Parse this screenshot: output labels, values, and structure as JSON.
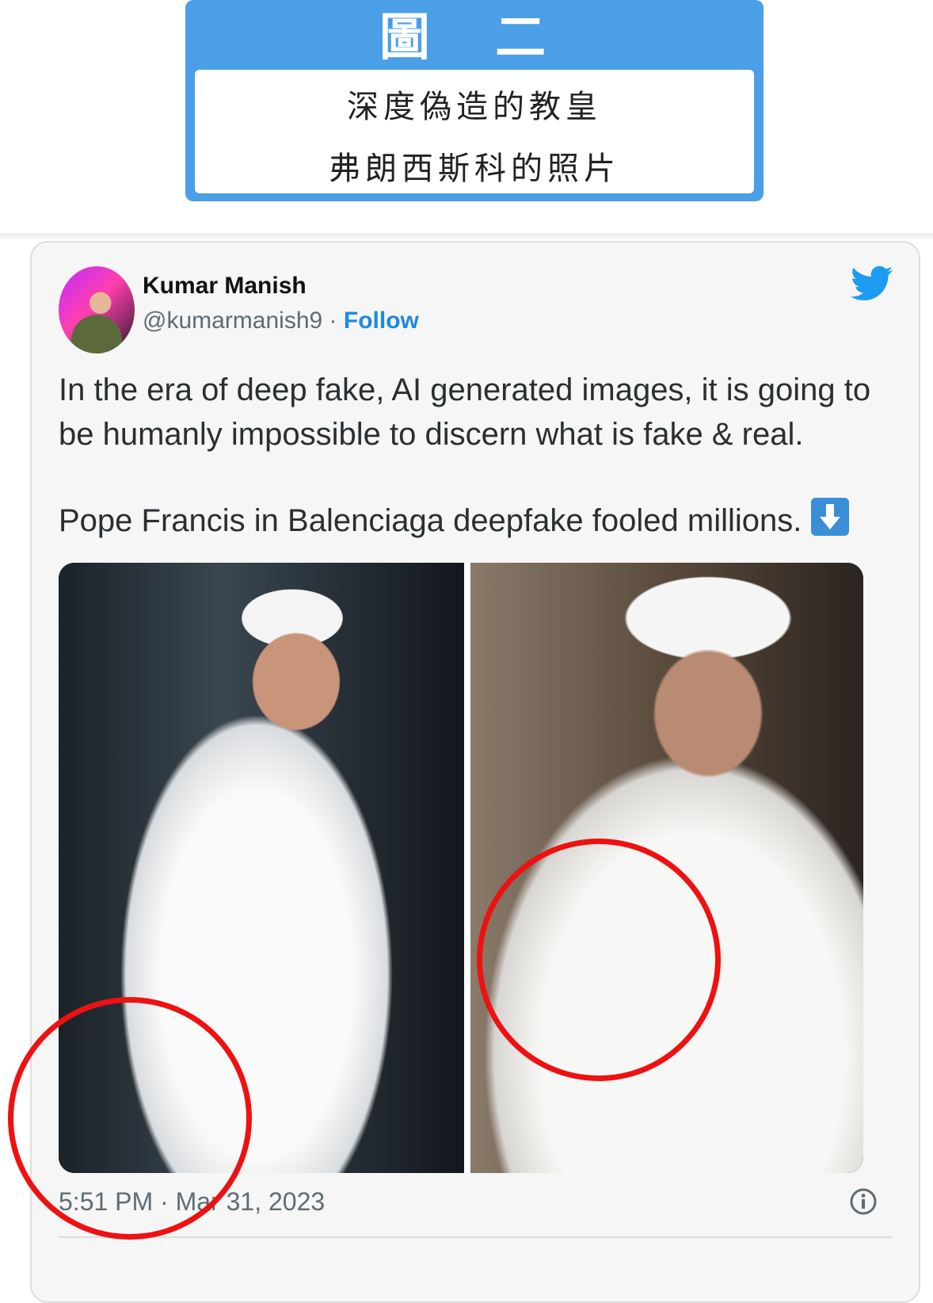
{
  "banner": {
    "title": "圖 二",
    "line1": "深度偽造的教皇",
    "line2": "弗朗西斯科的照片"
  },
  "tweet": {
    "author_name": "Kumar Manish",
    "handle": "@kumarmanish9",
    "separator": " · ",
    "follow_label": "Follow",
    "text_line1": "In the era of deep fake, AI generated images, it is going to be humanly impossible to discern what is fake & real.",
    "text_line2": "Pope Francis in Balenciaga deepfake fooled millions.",
    "timestamp": "5:51 PM · Mar 31, 2023",
    "icons": {
      "brand": "twitter-bird-icon",
      "emoji": "down-arrow-emoji-icon",
      "info": "info-icon"
    }
  },
  "colors": {
    "banner_blue": "#4a9fe6",
    "follow_blue": "#1d8adf",
    "annotation_red": "#ee1111"
  }
}
